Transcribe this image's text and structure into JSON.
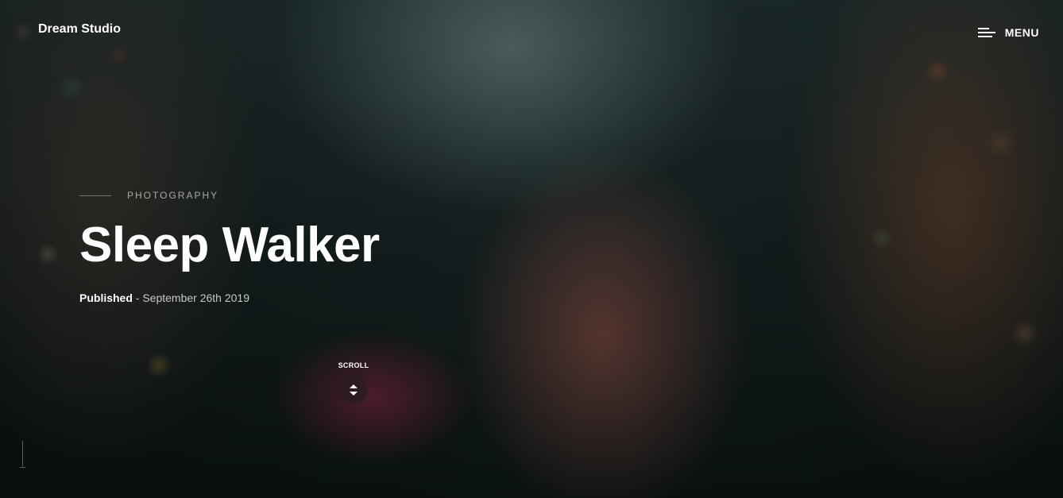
{
  "header": {
    "logo": "Dream Studio",
    "menu_label": "MENU"
  },
  "hero": {
    "category": "PHOTOGRAPHY",
    "title": "Sleep Walker",
    "published_label": "Published",
    "date": "- September 26th 2019",
    "scroll_label": "SCROLL"
  },
  "icons": {
    "menu": "hamburger-icon",
    "scroll": "up-down-arrows-icon"
  }
}
